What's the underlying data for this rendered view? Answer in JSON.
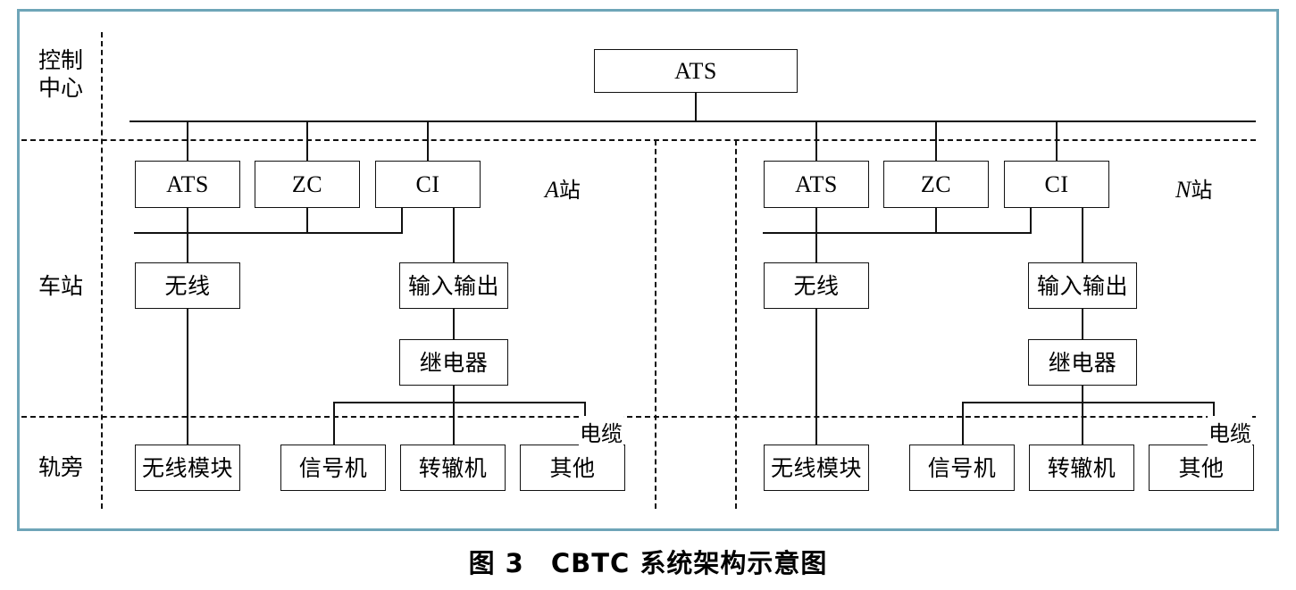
{
  "figure": {
    "caption": "图 3　CBTC 系统架构示意图",
    "frame_color": "#6ea5b8",
    "line_color": "#111111"
  },
  "row_labels": [
    {
      "id": "control-center",
      "text": "控制\n中心"
    },
    {
      "id": "station",
      "text": "车站"
    },
    {
      "id": "trackside",
      "text": "轨旁"
    }
  ],
  "station_labels": [
    {
      "id": "station-a",
      "letter": "A",
      "suffix": "站"
    },
    {
      "id": "station-n",
      "letter": "N",
      "suffix": "站"
    }
  ],
  "control_center": {
    "ats": "ATS"
  },
  "stations": [
    {
      "id": "a",
      "equipment": [
        {
          "id": "ats",
          "label": "ATS"
        },
        {
          "id": "zc",
          "label": "ZC"
        },
        {
          "id": "ci",
          "label": "CI"
        }
      ],
      "station_level": [
        {
          "id": "radio",
          "label": "无线"
        },
        {
          "id": "io",
          "label": "输入输出"
        },
        {
          "id": "relay",
          "label": "继电器"
        }
      ],
      "trackside": [
        {
          "id": "radio-module",
          "label": "无线模块"
        },
        {
          "id": "signal",
          "label": "信号机"
        },
        {
          "id": "switch",
          "label": "转辙机"
        },
        {
          "id": "other",
          "label": "其他"
        }
      ],
      "cable_label": "电缆"
    },
    {
      "id": "n",
      "equipment": [
        {
          "id": "ats",
          "label": "ATS"
        },
        {
          "id": "zc",
          "label": "ZC"
        },
        {
          "id": "ci",
          "label": "CI"
        }
      ],
      "station_level": [
        {
          "id": "radio",
          "label": "无线"
        },
        {
          "id": "io",
          "label": "输入输出"
        },
        {
          "id": "relay",
          "label": "继电器"
        }
      ],
      "trackside": [
        {
          "id": "radio-module",
          "label": "无线模块"
        },
        {
          "id": "signal",
          "label": "信号机"
        },
        {
          "id": "switch",
          "label": "转辙机"
        },
        {
          "id": "other",
          "label": "其他"
        }
      ],
      "cable_label": "电缆"
    }
  ]
}
